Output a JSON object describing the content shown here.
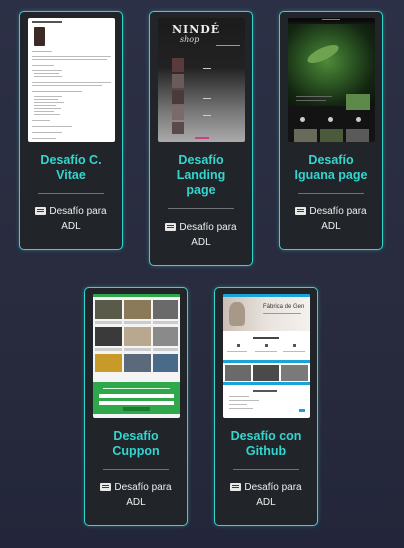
{
  "cards": [
    {
      "title_line1": "Desafío C.",
      "title_line2": "Vitae",
      "title_line3": "",
      "meta_line1": "Desafío para",
      "meta_line2": "ADL",
      "thumb": "curriculum-vitae-screenshot"
    },
    {
      "title_line1": "Desafío",
      "title_line2": "Landing",
      "title_line3": "page",
      "meta_line1": "Desafío para",
      "meta_line2": "ADL",
      "thumb": "ninde-shop-landing-screenshot"
    },
    {
      "title_line1": "Desafío",
      "title_line2": "Iguana page",
      "title_line3": "",
      "meta_line1": "Desafío para",
      "meta_line2": "ADL",
      "thumb": "iguana-page-screenshot"
    },
    {
      "title_line1": "Desafío",
      "title_line2": "Cuppon",
      "title_line3": "",
      "meta_line1": "Desafío para",
      "meta_line2": "ADL",
      "thumb": "cuppon-page-screenshot"
    },
    {
      "title_line1": "Desafío con",
      "title_line2": "Github",
      "title_line3": "",
      "meta_line1": "Desafío para",
      "meta_line2": "ADL",
      "thumb": "github-fabrica-screenshot"
    }
  ],
  "thumb_text": {
    "ninde_logo": "NINDÉ",
    "ninde_sub": "shop",
    "fabrica": "Fábrica de Gen"
  },
  "colors": {
    "accent": "#33d6cf",
    "card_bg": "#212429",
    "page_bg": "#282b3d"
  },
  "icons": {
    "meta": "keyboard-icon"
  }
}
